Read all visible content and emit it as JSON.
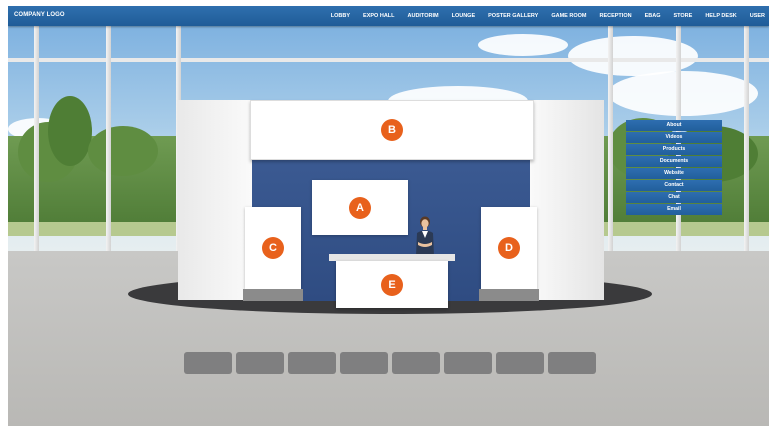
{
  "header": {
    "logo": "COMPANY LOGO",
    "nav": [
      "LOBBY",
      "EXPO HALL",
      "AUDITORIM",
      "LOUNGE",
      "POSTER GALLERY",
      "GAME ROOM",
      "RECEPTION",
      "EBAG",
      "STORE",
      "HELP DESK",
      "USER"
    ]
  },
  "booth": {
    "labels": {
      "a": "A",
      "b": "B",
      "c": "C",
      "d": "D",
      "e": "E"
    }
  },
  "side_menu": [
    "About",
    "Videos",
    "Products",
    "Documents",
    "Website",
    "Contact",
    "Chat",
    "Email"
  ],
  "bottom_buttons": [
    "",
    "",
    "",
    "",
    "",
    "",
    "",
    ""
  ],
  "colors": {
    "accent": "#e8611c",
    "nav": "#2567a5",
    "booth_back": "#35528a"
  }
}
